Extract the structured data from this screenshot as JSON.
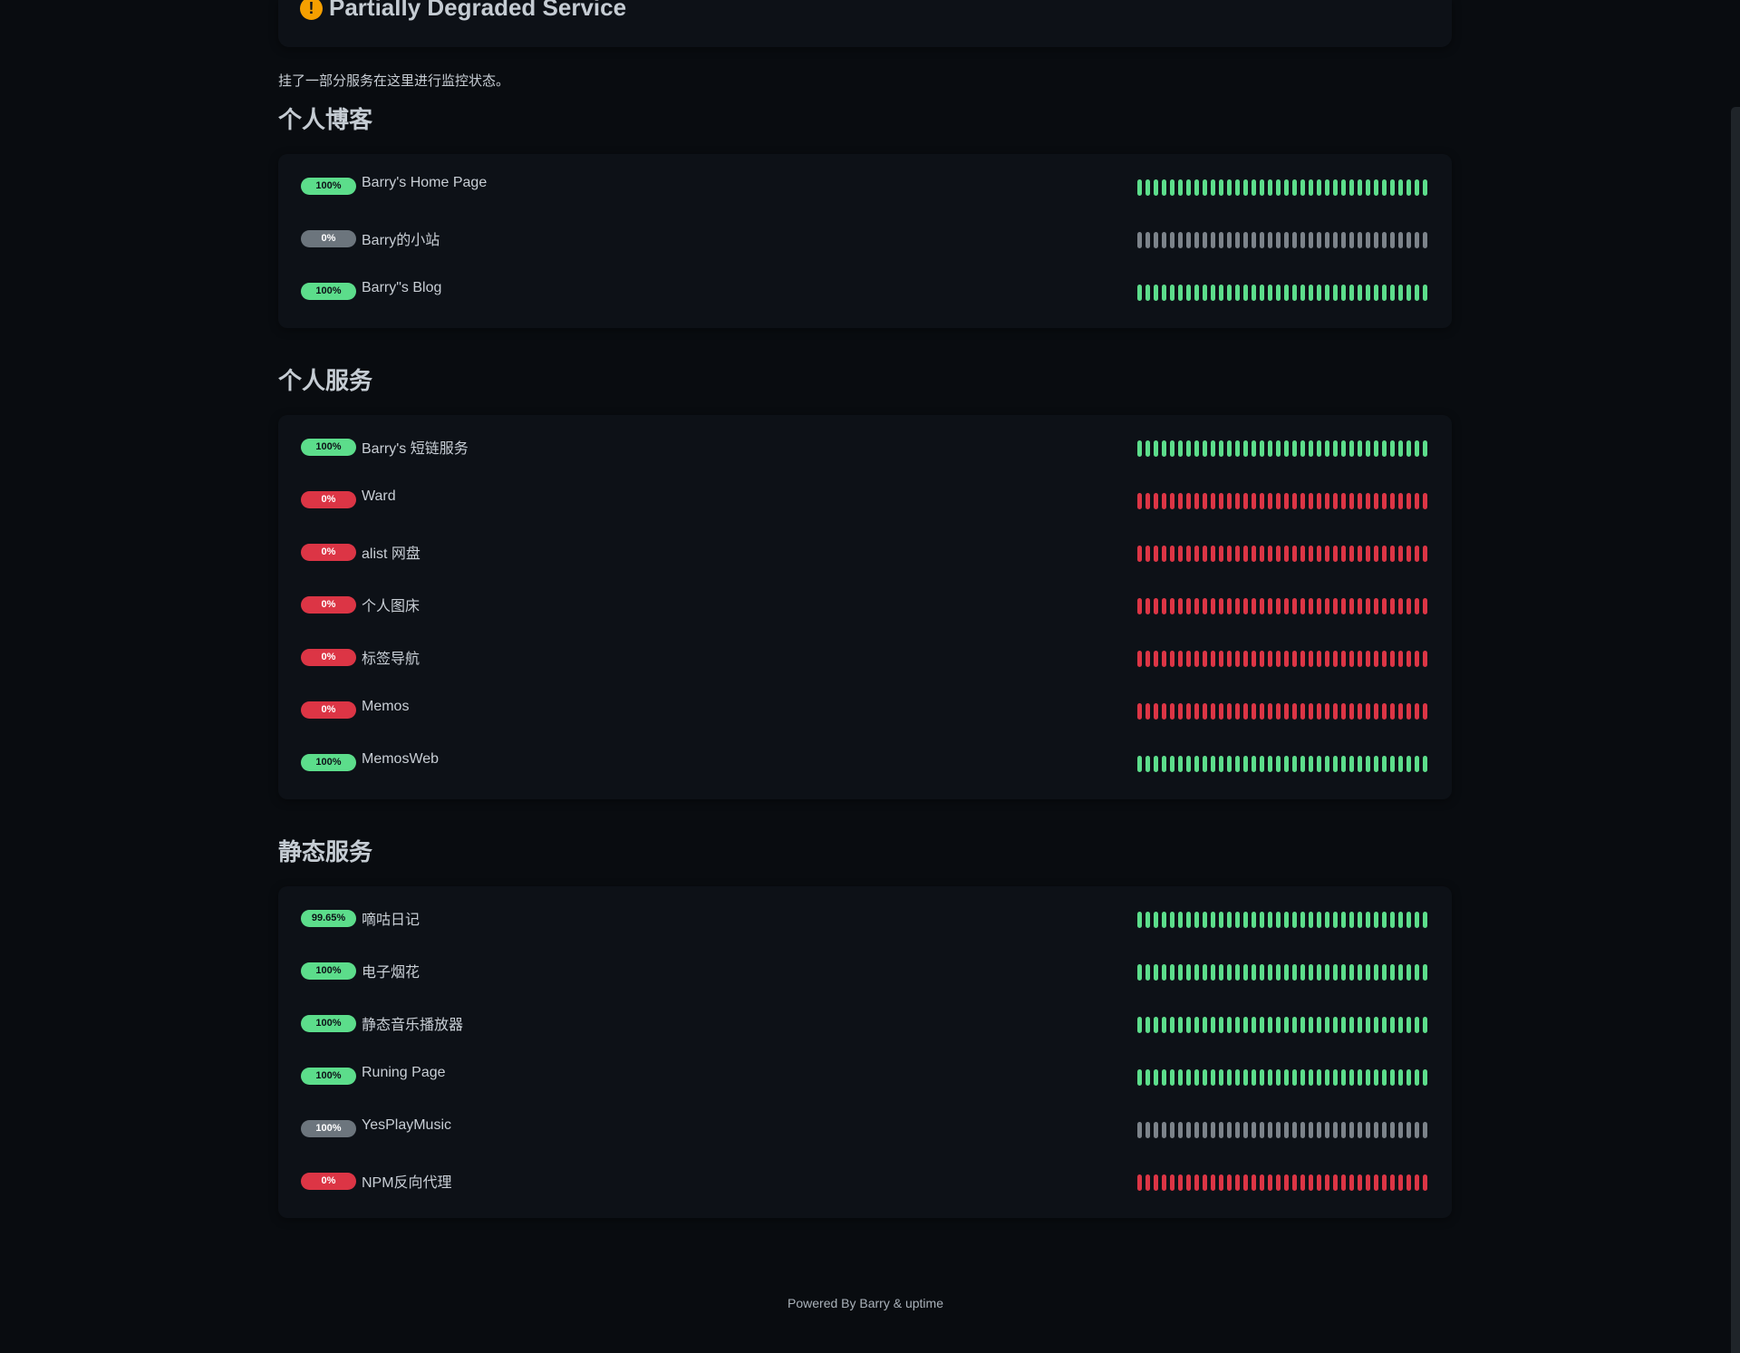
{
  "status": {
    "text": "Partially Degraded Service",
    "icon": "exclamation-icon",
    "icon_glyph": "!"
  },
  "description": "挂了一部分服务在这里进行监控状态。",
  "groups": [
    {
      "title": "个人博客",
      "monitors": [
        {
          "name": "Barry's Home Page",
          "uptime": "100%",
          "status": "green"
        },
        {
          "name": "Barry的小站",
          "uptime": "0%",
          "status": "gray"
        },
        {
          "name": "Barry\"s Blog",
          "uptime": "100%",
          "status": "green"
        }
      ]
    },
    {
      "title": "个人服务",
      "monitors": [
        {
          "name": "Barry's 短链服务",
          "uptime": "100%",
          "status": "green"
        },
        {
          "name": "Ward",
          "uptime": "0%",
          "status": "red"
        },
        {
          "name": "alist 网盘",
          "uptime": "0%",
          "status": "red"
        },
        {
          "name": "个人图床",
          "uptime": "0%",
          "status": "red"
        },
        {
          "name": "标签导航",
          "uptime": "0%",
          "status": "red"
        },
        {
          "name": "Memos",
          "uptime": "0%",
          "status": "red"
        },
        {
          "name": "MemosWeb",
          "uptime": "100%",
          "status": "green"
        }
      ]
    },
    {
      "title": "静态服务",
      "monitors": [
        {
          "name": "嘀咕日记",
          "uptime": "99.65%",
          "status": "green"
        },
        {
          "name": "电子烟花",
          "uptime": "100%",
          "status": "green"
        },
        {
          "name": "静态音乐播放器",
          "uptime": "100%",
          "status": "green"
        },
        {
          "name": "Runing Page",
          "uptime": "100%",
          "status": "green"
        },
        {
          "name": "YesPlayMusic",
          "uptime": "100%",
          "status": "gray"
        },
        {
          "name": "NPM反向代理",
          "uptime": "0%",
          "status": "red"
        }
      ]
    }
  ],
  "heartbeats_per_monitor": 36,
  "footer": "Powered By Barry & uptime",
  "colors": {
    "up": "#5cdd8b",
    "down": "#dc3545",
    "paused": "#7c838a",
    "warning": "#f59f00",
    "background": "#090c10",
    "card": "#0d1117"
  }
}
